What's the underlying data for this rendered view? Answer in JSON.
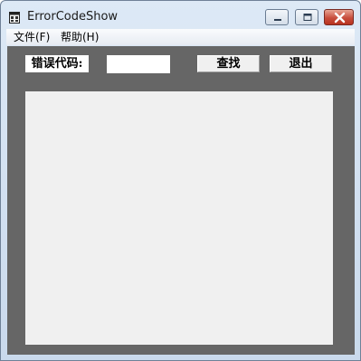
{
  "window": {
    "title": "ErrorCodeShow",
    "icon": "app-window-icon",
    "controls": [
      "minimize-icon",
      "maximize-icon",
      "close-icon"
    ]
  },
  "menu": {
    "file": "文件(F)",
    "help": "帮助(H)"
  },
  "form": {
    "error_code_label": "错误代码:",
    "error_code_value": "",
    "find_button": "查找",
    "exit_button": "退出"
  },
  "result": {
    "text": ""
  },
  "colors": {
    "client_background": "#666666",
    "result_background": "#f0f0f0",
    "close_button": "#c84e3d"
  }
}
